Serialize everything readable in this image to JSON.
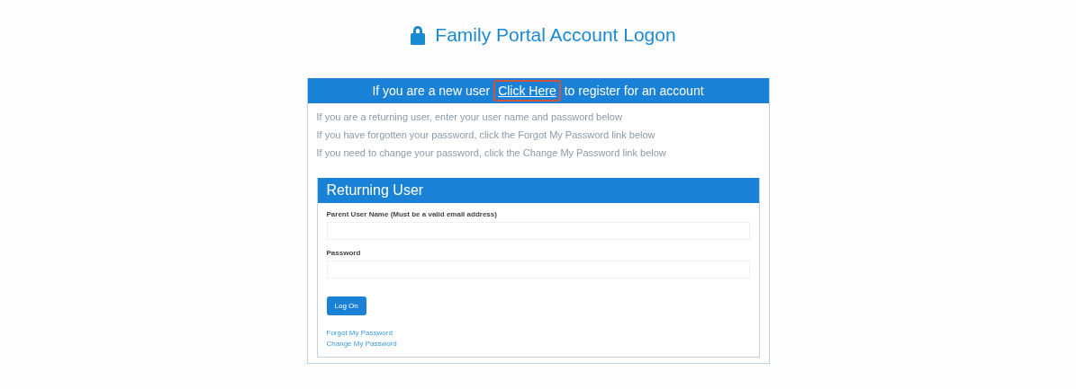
{
  "title": "Family Portal Account Logon",
  "banner": {
    "before": "If you are a new user",
    "link": {
      "label": "Click Here",
      "highlighted": true
    },
    "after": "to register for an account"
  },
  "instructions": [
    "If you are a returning user, enter your user name and password below",
    "If you have forgotten your password, click the Forgot My Password link below",
    "If you need to change your password, click the Change My Password link below"
  ],
  "login_panel": {
    "title": "Returning User",
    "fields": [
      {
        "label": "Parent User Name (Must be a valid email address)"
      },
      {
        "label": "Password"
      }
    ],
    "button": "Log On",
    "links": [
      "Forgot My Password",
      "Change My Password"
    ]
  }
}
